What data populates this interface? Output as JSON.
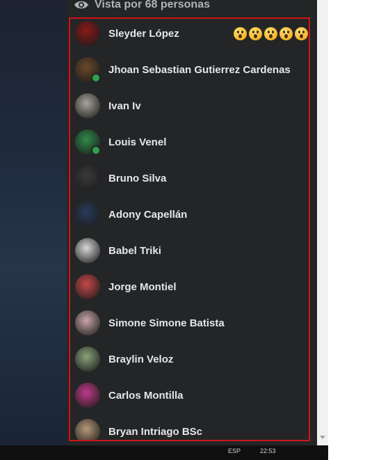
{
  "header": {
    "views_label": "Vista por 68 personas"
  },
  "viewers": [
    {
      "name": "Sleyder López",
      "online": false,
      "avatar": "#8a1a1a",
      "reactions": 5
    },
    {
      "name": "Jhoan Sebastian Gutierrez Cardenas",
      "online": true,
      "avatar": "#6b4a2a",
      "reactions": 0
    },
    {
      "name": "Ivan Iv",
      "online": false,
      "avatar": "#a8a49a",
      "reactions": 0
    },
    {
      "name": "Louis Venel",
      "online": true,
      "avatar": "#2f8a4a",
      "reactions": 0
    },
    {
      "name": "Bruno Silva",
      "online": false,
      "avatar": "#3a3a3a",
      "reactions": 0
    },
    {
      "name": "Adony Capellán",
      "online": false,
      "avatar": "#2a3a5a",
      "reactions": 0
    },
    {
      "name": "Babel Triki",
      "online": false,
      "avatar": "#d8d8d8",
      "reactions": 0
    },
    {
      "name": "Jorge Montiel",
      "online": false,
      "avatar": "#c84848",
      "reactions": 0
    },
    {
      "name": "Simone Simone Batista",
      "online": false,
      "avatar": "#c9a7a7",
      "reactions": 0
    },
    {
      "name": "Braylin Veloz",
      "online": false,
      "avatar": "#8aa27a",
      "reactions": 0
    },
    {
      "name": "Carlos Montilla",
      "online": false,
      "avatar": "#c03a8a",
      "reactions": 0
    },
    {
      "name": "Bryan Intriago BSc",
      "online": false,
      "avatar": "#b89a7a",
      "reactions": 0
    }
  ],
  "reaction_icon": "wow-emoji-icon",
  "colors": {
    "frame": "#d0141b",
    "panel": "#242526",
    "online": "#31a24c"
  },
  "taskbar": {
    "tray_left": "ESP",
    "tray_time": "22:53"
  }
}
